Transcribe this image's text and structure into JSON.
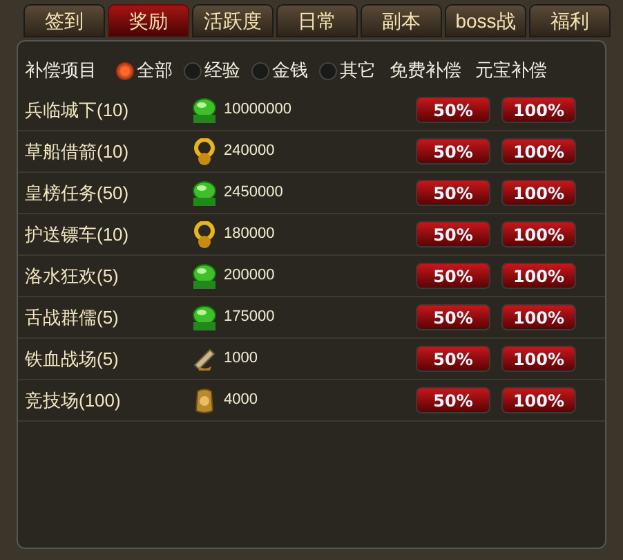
{
  "tabs": [
    {
      "label": "签到",
      "selected": false
    },
    {
      "label": "奖励",
      "selected": true
    },
    {
      "label": "活跃度",
      "selected": false
    },
    {
      "label": "日常",
      "selected": false
    },
    {
      "label": "副本",
      "selected": false
    },
    {
      "label": "boss战",
      "selected": false
    },
    {
      "label": "福利",
      "selected": false
    }
  ],
  "header": {
    "label": "补偿项目",
    "filters": [
      {
        "label": "全部",
        "selected": true
      },
      {
        "label": "经验",
        "selected": false
      },
      {
        "label": "金钱",
        "selected": false
      },
      {
        "label": "其它",
        "selected": false
      }
    ],
    "columns": [
      "免费补偿",
      "元宝补偿"
    ]
  },
  "rows": [
    {
      "name": "兵临城下(10)",
      "kind": "exp",
      "amount": "10000000",
      "free": "50%",
      "paid": "100%"
    },
    {
      "name": "草船借箭(10)",
      "kind": "coin",
      "amount": "240000",
      "free": "50%",
      "paid": "100%"
    },
    {
      "name": "皇榜任务(50)",
      "kind": "exp",
      "amount": "2450000",
      "free": "50%",
      "paid": "100%"
    },
    {
      "name": "护送镖车(10)",
      "kind": "coin",
      "amount": "180000",
      "free": "50%",
      "paid": "100%"
    },
    {
      "name": "洛水狂欢(5)",
      "kind": "exp",
      "amount": "200000",
      "free": "50%",
      "paid": "100%"
    },
    {
      "name": "舌战群儒(5)",
      "kind": "exp",
      "amount": "175000",
      "free": "50%",
      "paid": "100%"
    },
    {
      "name": "铁血战场(5)",
      "kind": "scroll",
      "amount": "1000",
      "free": "50%",
      "paid": "100%"
    },
    {
      "name": "竞技场(100)",
      "kind": "medal",
      "amount": "4000",
      "free": "50%",
      "paid": "100%"
    }
  ]
}
